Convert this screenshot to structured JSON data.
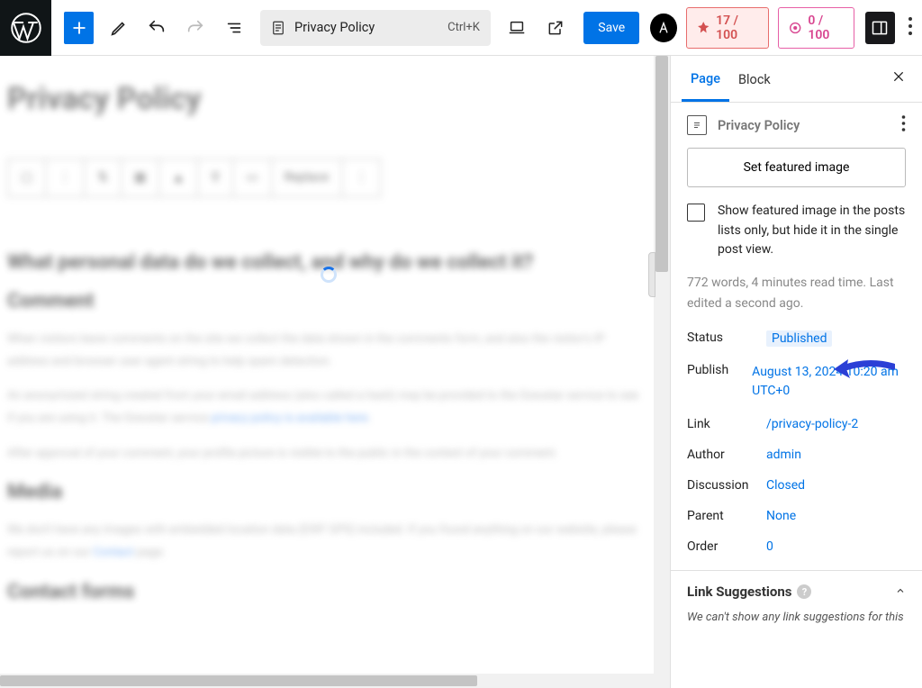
{
  "topbar": {
    "page_title": "Privacy Policy",
    "shortcut": "Ctrl+K",
    "save_label": "Save",
    "score1": "17 / 100",
    "score2": "0 / 100"
  },
  "canvas": {
    "h1": "Privacy Policy",
    "toolbar_replace": "Replace",
    "h2a": "What personal data do we collect, and why do we collect it?",
    "h3a": "Comment",
    "p1": "When visitors leave comments on the site we collect the data shown in the comments form, and also the visitor's IP address and browser user agent string to help spam detection.",
    "p2_a": "An anonymized string created from your email address (also called a hash) may be provided to the Gravatar service to see if you are using it. The Gravatar service ",
    "p2_link": "privacy policy is available here",
    "p3": "After approval of your comment, your profile picture is visible to the public in the context of your comment.",
    "h3b": "Media",
    "p4_a": "We don't have any images with embedded location data (EXIF GPS) included. If you found anything on our website, please report us on our ",
    "p4_link": "Contact",
    "p4_b": " page.",
    "h3c": "Contact forms"
  },
  "sidebar": {
    "tabs": {
      "page": "Page",
      "block": "Block"
    },
    "doc_title": "Privacy Policy",
    "featured_btn": "Set featured image",
    "chk_label": "Show featured image in the posts lists only, but hide it in the single post view.",
    "meta": "772 words, 4 minutes read time. Last edited a second ago.",
    "rows": {
      "status_k": "Status",
      "status_v": "Published",
      "publish_k": "Publish",
      "publish_v": "August 13, 2024 10:20 am UTC+0",
      "link_k": "Link",
      "link_v": "/privacy-policy-2",
      "author_k": "Author",
      "author_v": "admin",
      "discussion_k": "Discussion",
      "discussion_v": "Closed",
      "parent_k": "Parent",
      "parent_v": "None",
      "order_k": "Order",
      "order_v": "0"
    },
    "accordion": {
      "title": "Link Suggestions",
      "body": "We can't show any link suggestions for this"
    }
  }
}
